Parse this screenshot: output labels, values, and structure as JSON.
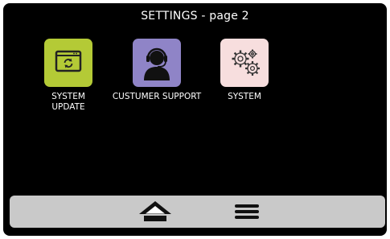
{
  "header": {
    "title": "SETTINGS - page 2"
  },
  "apps": [
    {
      "label": "SYSTEM\nUPDATE",
      "icon": "system-update-icon",
      "color": "#b4ca36"
    },
    {
      "label": "CUSTUMER SUPPORT",
      "icon": "headset-support-icon",
      "color": "#8f84c7"
    },
    {
      "label": "SYSTEM",
      "icon": "gears-icon",
      "color": "#f7dede"
    }
  ],
  "bottom_bar": {
    "home": {
      "icon": "home-icon"
    },
    "menu": {
      "icon": "menu-icon"
    }
  },
  "colors": {
    "background": "#000000",
    "bar": "#c9c9c9",
    "text": "#ffffff"
  }
}
